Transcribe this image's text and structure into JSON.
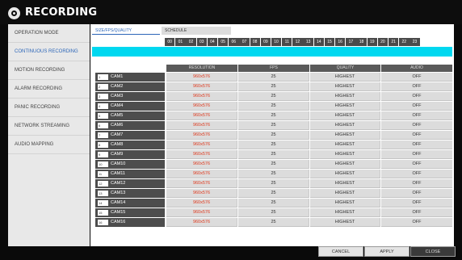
{
  "window": {
    "title": "RECORDING",
    "icon": "settings-wheel-icon"
  },
  "sidebar": {
    "items": [
      {
        "label": "OPERATION MODE",
        "active": false
      },
      {
        "label": "CONTINUOUS RECORDING",
        "active": true
      },
      {
        "label": "MOTION RECORDING",
        "active": false
      },
      {
        "label": "ALARM RECORDING",
        "active": false
      },
      {
        "label": "PANIC RECORDING",
        "active": false
      },
      {
        "label": "NETWORK STREAMING",
        "active": false
      },
      {
        "label": "AUDIO MAPPING",
        "active": false
      }
    ]
  },
  "tabs": [
    {
      "label": "SIZE/FPS/QUALITY",
      "active": true
    },
    {
      "label": "SCHEDULE",
      "active": false
    }
  ],
  "hours": [
    "00",
    "01",
    "02",
    "03",
    "04",
    "05",
    "06",
    "07",
    "08",
    "09",
    "10",
    "11",
    "12",
    "13",
    "14",
    "15",
    "16",
    "17",
    "18",
    "19",
    "20",
    "21",
    "22",
    "23"
  ],
  "table": {
    "headers": {
      "resolution": "RESOLUTION",
      "fps": "FPS",
      "quality": "QUALITY",
      "audio": "AUDIO"
    },
    "rows": [
      {
        "camera": "CAM1",
        "icon": "1",
        "resolution": "960x576",
        "fps": "25",
        "quality": "HIGHEST",
        "audio": "OFF"
      },
      {
        "camera": "CAM2",
        "icon": "2",
        "resolution": "960x576",
        "fps": "25",
        "quality": "HIGHEST",
        "audio": "OFF"
      },
      {
        "camera": "CAM3",
        "icon": "3",
        "resolution": "960x576",
        "fps": "25",
        "quality": "HIGHEST",
        "audio": "OFF"
      },
      {
        "camera": "CAM4",
        "icon": "4",
        "resolution": "960x576",
        "fps": "25",
        "quality": "HIGHEST",
        "audio": "OFF"
      },
      {
        "camera": "CAM5",
        "icon": "5",
        "resolution": "960x576",
        "fps": "25",
        "quality": "HIGHEST",
        "audio": "OFF"
      },
      {
        "camera": "CAM6",
        "icon": "6",
        "resolution": "960x576",
        "fps": "25",
        "quality": "HIGHEST",
        "audio": "OFF"
      },
      {
        "camera": "CAM7",
        "icon": "7",
        "resolution": "960x576",
        "fps": "25",
        "quality": "HIGHEST",
        "audio": "OFF"
      },
      {
        "camera": "CAM8",
        "icon": "8",
        "resolution": "960x576",
        "fps": "25",
        "quality": "HIGHEST",
        "audio": "OFF"
      },
      {
        "camera": "CAM9",
        "icon": "9",
        "resolution": "960x576",
        "fps": "25",
        "quality": "HIGHEST",
        "audio": "OFF"
      },
      {
        "camera": "CAM10",
        "icon": "10",
        "resolution": "960x576",
        "fps": "25",
        "quality": "HIGHEST",
        "audio": "OFF"
      },
      {
        "camera": "CAM11",
        "icon": "11",
        "resolution": "960x576",
        "fps": "25",
        "quality": "HIGHEST",
        "audio": "OFF"
      },
      {
        "camera": "CAM12",
        "icon": "12",
        "resolution": "960x576",
        "fps": "25",
        "quality": "HIGHEST",
        "audio": "OFF"
      },
      {
        "camera": "CAM13",
        "icon": "13",
        "resolution": "960x576",
        "fps": "25",
        "quality": "HIGHEST",
        "audio": "OFF"
      },
      {
        "camera": "CAM14",
        "icon": "14",
        "resolution": "960x576",
        "fps": "25",
        "quality": "HIGHEST",
        "audio": "OFF"
      },
      {
        "camera": "CAM15",
        "icon": "15",
        "resolution": "960x576",
        "fps": "25",
        "quality": "HIGHEST",
        "audio": "OFF"
      },
      {
        "camera": "CAM16",
        "icon": "16",
        "resolution": "960x576",
        "fps": "25",
        "quality": "HIGHEST",
        "audio": "OFF"
      }
    ]
  },
  "buttons": {
    "cancel": "CANCEL",
    "apply": "APPLY",
    "close": "CLOSE"
  },
  "colors": {
    "accent": "#2c66b8",
    "schedule_bar": "#00d8f0",
    "resolution_text": "#e03a1e"
  }
}
